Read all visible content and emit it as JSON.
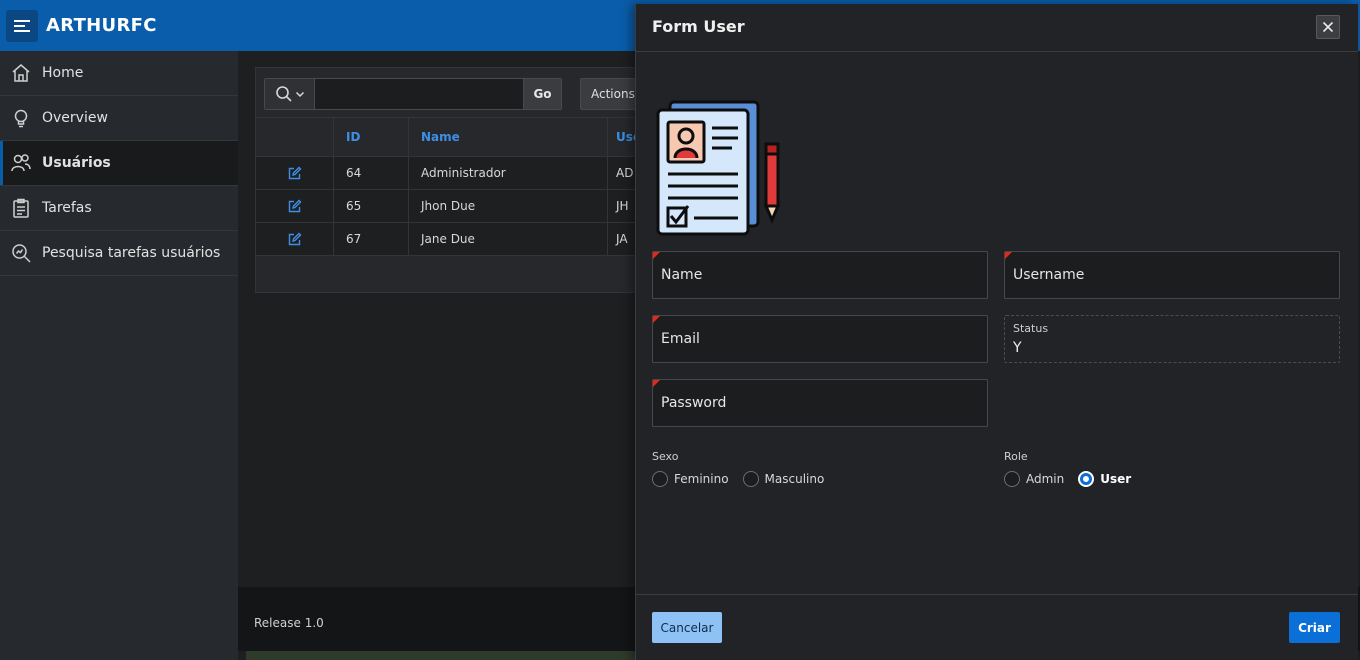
{
  "header": {
    "app_title": "ARTHURFC"
  },
  "sidebar": {
    "items": [
      {
        "label": "Home",
        "icon": "home-icon",
        "active": false
      },
      {
        "label": "Overview",
        "icon": "lightbulb-icon",
        "active": false
      },
      {
        "label": "Usuários",
        "icon": "users-icon",
        "active": true
      },
      {
        "label": "Tarefas",
        "icon": "clipboard-icon",
        "active": false
      },
      {
        "label": "Pesquisa tarefas usuários",
        "icon": "search-chart-icon",
        "active": false
      }
    ]
  },
  "report": {
    "search": {
      "placeholder": "",
      "value": ""
    },
    "go_label": "Go",
    "actions_label": "Actions",
    "columns": [
      "ID",
      "Name",
      "Use"
    ],
    "rows": [
      {
        "id": "64",
        "name": "Administrador",
        "user": "AD"
      },
      {
        "id": "65",
        "name": "Jhon Due",
        "user": "JH"
      },
      {
        "id": "67",
        "name": "Jane Due",
        "user": "JA"
      }
    ]
  },
  "footer": {
    "release": "Release 1.0"
  },
  "dialog": {
    "title": "Form User",
    "fields": {
      "name": "Name",
      "username": "Username",
      "email": "Email",
      "password": "Password"
    },
    "status": {
      "label": "Status",
      "value": "Y"
    },
    "sexo": {
      "label": "Sexo",
      "options": [
        "Feminino",
        "Masculino"
      ],
      "selected": null
    },
    "role": {
      "label": "Role",
      "options": [
        "Admin",
        "User"
      ],
      "selected": "User"
    },
    "cancel_label": "Cancelar",
    "create_label": "Criar"
  },
  "colors": {
    "header": "#0a5dab",
    "required_marker": "#e0261f",
    "primary_button": "#0a6fd6",
    "cancel_button": "#8ec2f5",
    "link": "#3d8fe6"
  }
}
